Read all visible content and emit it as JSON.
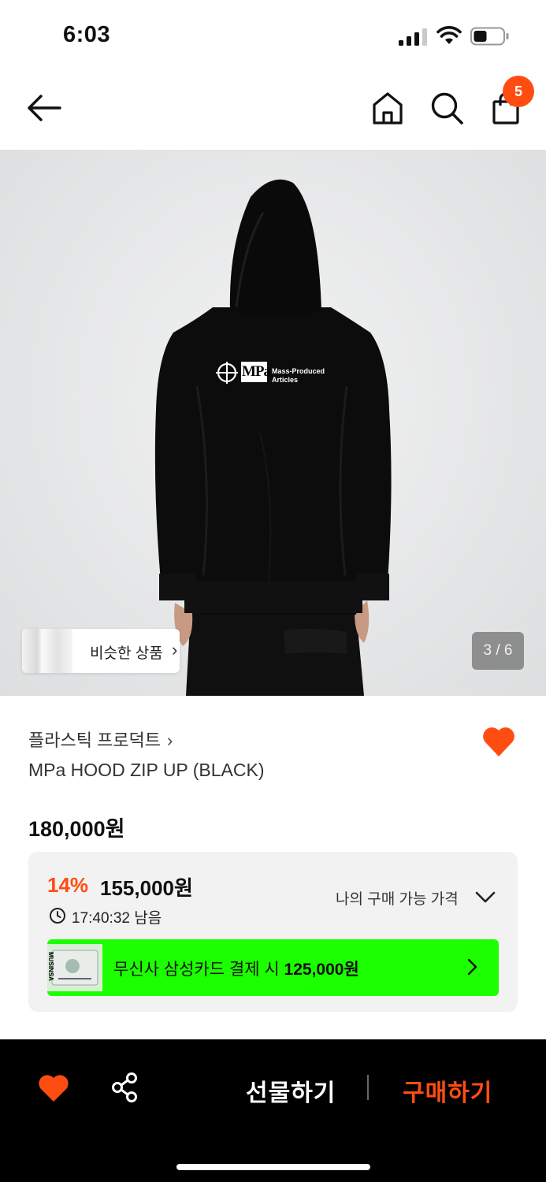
{
  "status_bar": {
    "time": "6:03"
  },
  "header": {
    "back_icon": "arrow-left-icon",
    "home_icon": "home-icon",
    "search_icon": "search-icon",
    "cart_icon": "shopping-bag-icon",
    "cart_count": "5",
    "badge_color": "#ff4d12"
  },
  "gallery": {
    "similar_label": "비슷한 상품",
    "page_indicator": "3 / 6",
    "logo": {
      "mark": "MPa",
      "line1": "Mass-Produced",
      "line2": "Articles"
    }
  },
  "product": {
    "brand": "플라스틱 프로덕트",
    "name": "MPa HOOD ZIP UP (BLACK)",
    "original_price": "180,000원",
    "liked": true
  },
  "price_box": {
    "discount": "14%",
    "sale_price": "155,000원",
    "timer": "17:40:32 남음",
    "my_price_label": "나의 구매 가능 가격",
    "card_promo_prefix": "무신사 삼성카드 결제 시 ",
    "card_promo_price": "125,000원",
    "card_brand": "MUSINSA",
    "promo_color": "#1cff00"
  },
  "bottom_bar": {
    "gift_label": "선물하기",
    "buy_label": "구매하기",
    "accent": "#ff4d12"
  }
}
